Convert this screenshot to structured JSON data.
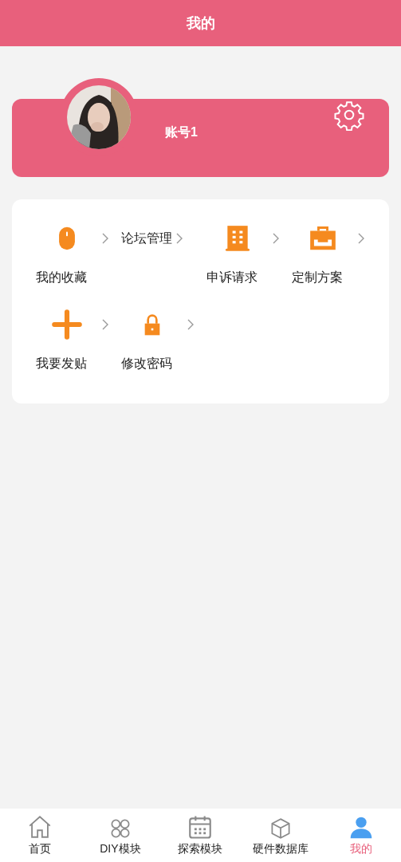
{
  "header": {
    "title": "我的"
  },
  "profile": {
    "account": "账号1"
  },
  "menu": [
    {
      "label": "我的收藏"
    },
    {
      "label": "论坛管理"
    },
    {
      "label": "申诉请求"
    },
    {
      "label": "定制方案"
    },
    {
      "label": "我要发贴"
    },
    {
      "label": "修改密码"
    }
  ],
  "tabs": [
    {
      "label": "首页",
      "selected": false
    },
    {
      "label": "DIY模块",
      "selected": false
    },
    {
      "label": "探索模块",
      "selected": false
    },
    {
      "label": "硬件数据库",
      "selected": false
    },
    {
      "label": "我的",
      "selected": true
    }
  ]
}
